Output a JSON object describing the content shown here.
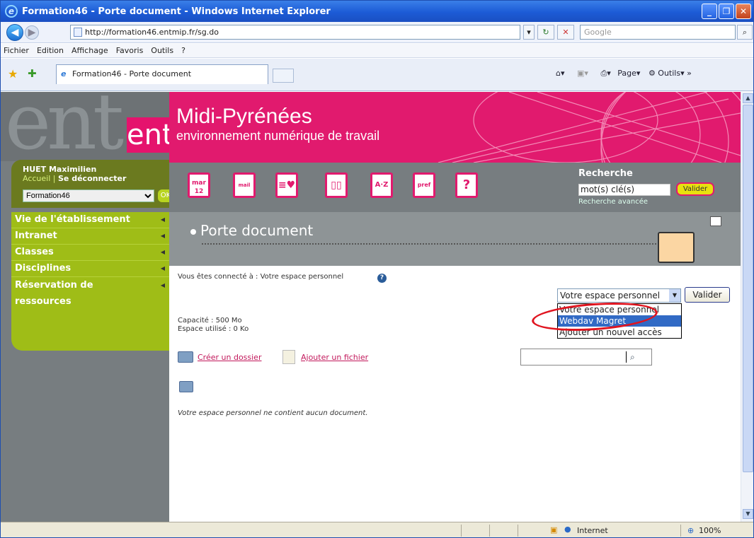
{
  "window": {
    "title": "Formation46 - Porte document - Windows Internet Explorer"
  },
  "browser": {
    "url": "http://formation46.entmip.fr/sg.do",
    "search_placeholder": "Google",
    "menu": [
      "Fichier",
      "Edition",
      "Affichage",
      "Favoris",
      "Outils",
      "?"
    ],
    "tab_label": "Formation46 - Porte document",
    "tools": {
      "page": "Page",
      "outils": "Outils"
    },
    "status": {
      "zone": "Internet",
      "zoom": "100%"
    }
  },
  "sidebar": {
    "logo_text": "ent",
    "user_name": "HUET Maximilien",
    "link_home": "Accueil",
    "link_sep": "|",
    "link_logout": "Se déconnecter",
    "establishment": "Formation46",
    "ok_label": "OK",
    "menu": [
      {
        "label": "Vie de l'établissement"
      },
      {
        "label": "Intranet"
      },
      {
        "label": "Classes"
      },
      {
        "label": "Disciplines"
      },
      {
        "label": "Réservation de ressources"
      }
    ]
  },
  "header": {
    "title": "Midi-Pyrénées",
    "subtitle": "environnement numérique de travail"
  },
  "toolbar_icons": {
    "calendar_month": "mar",
    "calendar_day": "12",
    "mail": "mail",
    "pref": "pref",
    "help": "?"
  },
  "search": {
    "title": "Recherche",
    "value": "mot(s) clé(s)",
    "button": "Valider",
    "advanced": "Recherche avancée"
  },
  "main": {
    "title": "Porte document",
    "connected_label": "Vous êtes connecté à : Votre espace personnel",
    "capacity": "Capacité : 500 Mo",
    "used": "Espace utilisé : 0 Ko",
    "space_select": {
      "selected": "Votre espace personnel",
      "options": [
        "Votre espace personnel",
        "Webdav Magret",
        "Ajouter un nouvel accès"
      ]
    },
    "validate_button": "Valider",
    "create_folder": "Créer un dossier",
    "add_file": "Ajouter un fichier",
    "empty_message": "Votre espace personnel ne contient aucun document."
  }
}
